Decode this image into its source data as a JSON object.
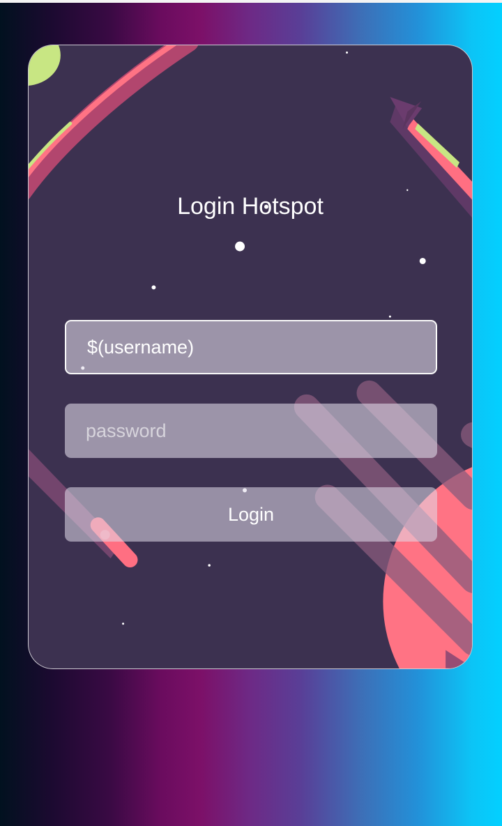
{
  "page": {
    "title": "Login Hotspot"
  },
  "form": {
    "username_placeholder": "$(username)",
    "username_value": "",
    "password_placeholder": "password",
    "password_value": "",
    "login_label": "Login"
  },
  "colors": {
    "card_bg": "#3c3150",
    "planet": "#ff7384",
    "comet": "#ff6f82",
    "planet_green": "#c8e683",
    "gradient_start": "#01111f",
    "gradient_mid": "#7c1068",
    "gradient_end": "#03d0ff"
  },
  "icons": {
    "decor": [
      "rocket-icon",
      "planet-icon",
      "comet-icon",
      "star-icon"
    ]
  }
}
